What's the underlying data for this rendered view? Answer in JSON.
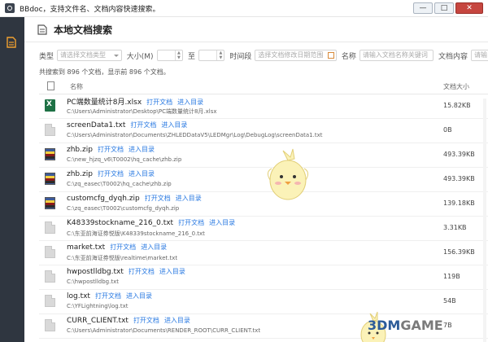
{
  "window": {
    "title": "BBdoc，支持文件名、文档内容快速搜索。",
    "min_label": "—",
    "max_label": "□",
    "close_label": "✕"
  },
  "header": {
    "title": "本地文档搜索"
  },
  "filters": {
    "type_label": "类型",
    "type_placeholder": "请选择文档类型",
    "size_label": "大小(M)",
    "to_label": "至",
    "time_label": "时间段",
    "time_placeholder": "选择文档修改日期范围",
    "name_label": "名称",
    "name_placeholder": "请输入文档名称关键词",
    "content_label": "文档内容",
    "content_placeholder": "请输"
  },
  "summary": "共搜索到 896 个文档，显示前 896 个文档。",
  "columns": {
    "name": "名称",
    "size": "文档大小"
  },
  "links": {
    "open": "打开文档",
    "dir": "进入目录"
  },
  "rows": [
    {
      "icon": "xlsx",
      "name": "PC端数量统计8月.xlsx",
      "path": "C:\\Users\\Administrator\\Desktop\\PC端数量统计8月.xlsx",
      "size": "15.82KB"
    },
    {
      "icon": "txt",
      "name": "screenData1.txt",
      "path": "C:\\Users\\Administrator\\Documents\\ZHLEDDataV5\\LEDMgr\\Log\\DebugLog\\screenData1.txt",
      "size": "0B"
    },
    {
      "icon": "zip",
      "name": "zhb.zip",
      "path": "C:\\new_hjzq_v6\\T0002\\hq_cache\\zhb.zip",
      "size": "493.39KB"
    },
    {
      "icon": "zip",
      "name": "zhb.zip",
      "path": "C:\\zq_easec\\T0002\\hq_cache\\zhb.zip",
      "size": "493.39KB"
    },
    {
      "icon": "zip",
      "name": "customcfg_dyqh.zip",
      "path": "C:\\zq_easec\\T0002\\customcfg_dyqh.zip",
      "size": "139.18KB"
    },
    {
      "icon": "txt",
      "name": "K48339stockname_216_0.txt",
      "path": "C:\\东亚前海证券悦版\\K48339stockname_216_0.txt",
      "size": "3.31KB"
    },
    {
      "icon": "txt",
      "name": "market.txt",
      "path": "C:\\东亚前海证券悦版\\realtime\\market.txt",
      "size": "156.39KB"
    },
    {
      "icon": "txt",
      "name": "hwpostlldbg.txt",
      "path": "C:\\hwpostlldbg.txt",
      "size": "119B"
    },
    {
      "icon": "txt",
      "name": "log.txt",
      "path": "C:\\YFLightning\\log.txt",
      "size": "54B"
    },
    {
      "icon": "txt",
      "name": "CURR_CLIENT.txt",
      "path": "C:\\Users\\Administrator\\Documents\\RENDER_ROOT\\CURR_CLIENT.txt",
      "size": "7B"
    }
  ],
  "watermark": {
    "main": "3DM",
    "accent": "GAME"
  }
}
